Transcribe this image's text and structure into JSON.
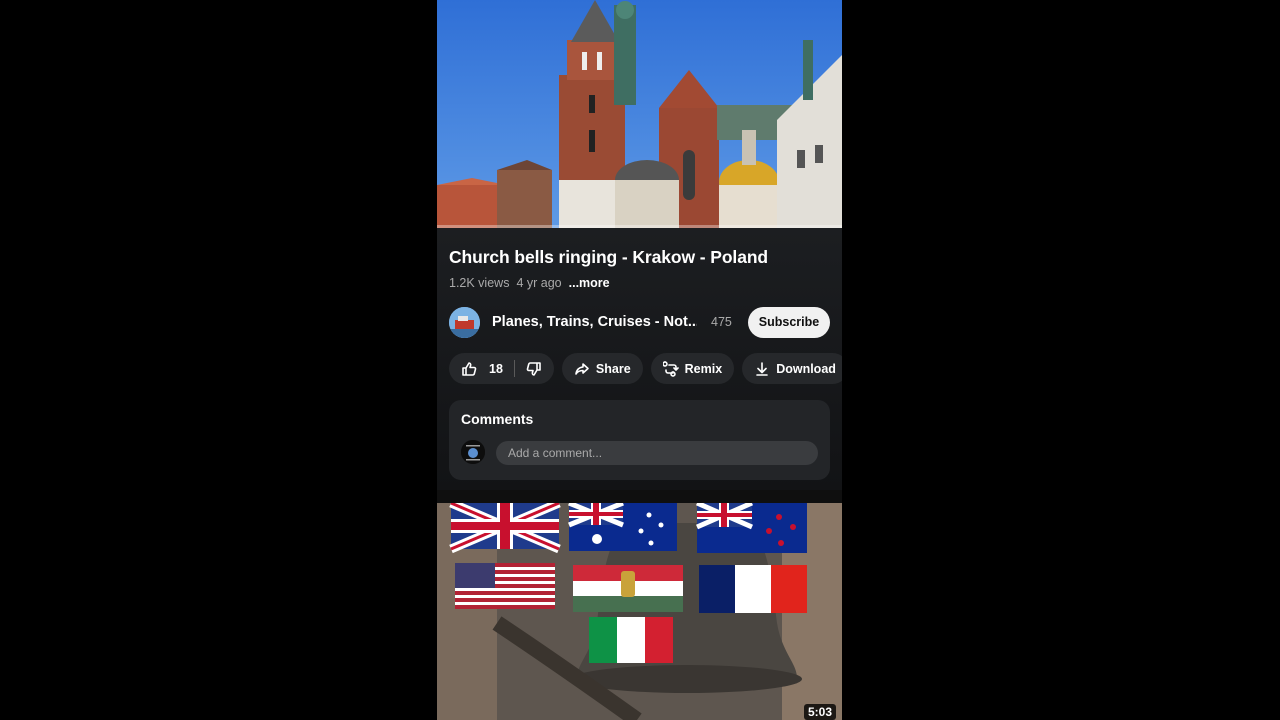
{
  "video": {
    "title": "Church bells ringing - Krakow - Poland",
    "views": "1.2K views",
    "age": "4 yr ago",
    "more_label": "...more",
    "progress": 0
  },
  "channel": {
    "name": "Planes, Trains, Cruises - Not...",
    "subscribers": "475",
    "subscribe_label": "Subscribe"
  },
  "actions": {
    "like_count": "18",
    "share_label": "Share",
    "remix_label": "Remix",
    "download_label": "Download"
  },
  "comments": {
    "title": "Comments",
    "placeholder": "Add a comment..."
  },
  "next_video": {
    "duration": "5:03"
  },
  "icons": [
    "thumbs-up-icon",
    "thumbs-down-icon",
    "share-icon",
    "remix-icon",
    "download-icon"
  ]
}
